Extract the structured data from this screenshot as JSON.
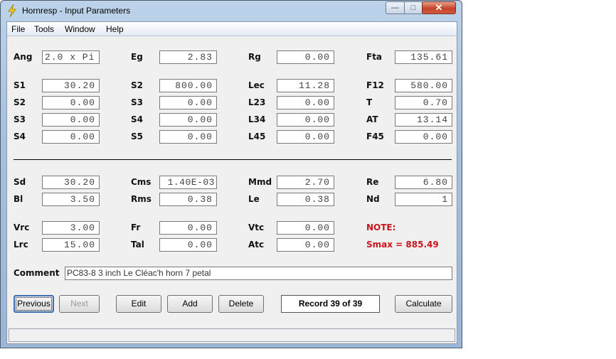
{
  "window": {
    "title": "Hornresp - Input Parameters"
  },
  "menu": [
    "File",
    "Tools",
    "Window",
    "Help"
  ],
  "fields": {
    "Ang": "2.0 x Pi",
    "Eg": "2.83",
    "Rg": "0.00",
    "Fta": "135.61",
    "S1": "30.20",
    "S2a": "800.00",
    "Lec": "11.28",
    "F12": "580.00",
    "S2b": "0.00",
    "S3a": "0.00",
    "L23": "0.00",
    "T": "0.70",
    "S3b": "0.00",
    "S4a": "0.00",
    "L34": "0.00",
    "AT": "13.14",
    "S4b": "0.00",
    "S5": "0.00",
    "L45": "0.00",
    "F45": "0.00",
    "Sd": "30.20",
    "Cms": "1.40E-03",
    "Mmd": "2.70",
    "Re": "6.80",
    "Bl": "3.50",
    "Rms": "0.38",
    "Le": "0.38",
    "Nd": "1",
    "Vrc": "3.00",
    "Fr": "0.00",
    "Vtc": "0.00",
    "Lrc": "15.00",
    "Tal": "0.00",
    "Atc": "0.00"
  },
  "labels": {
    "Ang": "Ang",
    "Eg": "Eg",
    "Rg": "Rg",
    "Fta": "Fta",
    "S1": "S1",
    "S2a": "S2",
    "Lec": "Lec",
    "F12": "F12",
    "S2b": "S2",
    "S3a": "S3",
    "L23": "L23",
    "T": "T",
    "S3b": "S3",
    "S4a": "S4",
    "L34": "L34",
    "AT": "AT",
    "S4b": "S4",
    "S5": "S5",
    "L45": "L45",
    "F45": "F45",
    "Sd": "Sd",
    "Cms": "Cms",
    "Mmd": "Mmd",
    "Re": "Re",
    "Bl": "Bl",
    "Rms": "Rms",
    "Le": "Le",
    "Nd": "Nd",
    "Vrc": "Vrc",
    "Fr": "Fr",
    "Vtc": "Vtc",
    "Lrc": "Lrc",
    "Tal": "Tal",
    "Atc": "Atc"
  },
  "note": {
    "label": "NOTE:",
    "smax": "Smax = 885.49"
  },
  "comment": {
    "label": "Comment",
    "value": "PC83-8 3 inch  Le Cléac'h horn 7 petal"
  },
  "buttons": {
    "previous": "Previous",
    "next": "Next",
    "edit": "Edit",
    "add": "Add",
    "delete": "Delete",
    "calculate": "Calculate"
  },
  "record": "Record 39 of 39",
  "colors": {
    "note": "#c8141e",
    "titlebar": "#a7c0dc"
  }
}
